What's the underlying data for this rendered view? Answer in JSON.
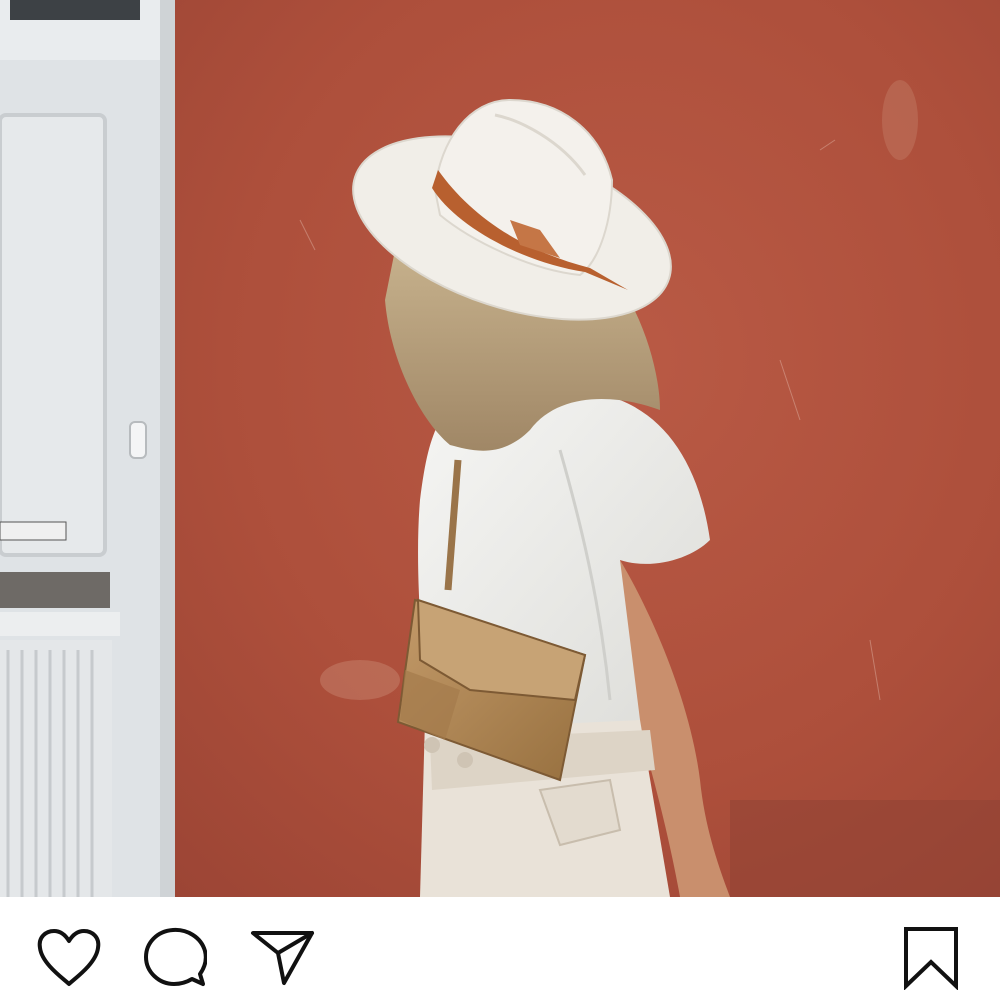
{
  "post": {
    "image_subject": "photo-of-woman-in-white-fedora-against-red-wall"
  },
  "actions": {
    "like_icon": "heart-outline-icon",
    "comment_icon": "speech-bubble-icon",
    "share_icon": "paper-plane-icon",
    "save_icon": "bookmark-outline-icon"
  },
  "colors": {
    "wall": "#b5543f",
    "door": "#dfe3e6",
    "hat": "#f1eee8",
    "hat_band": "#b8602f",
    "bag": "#b48a5b",
    "icon_stroke": "#111111"
  }
}
